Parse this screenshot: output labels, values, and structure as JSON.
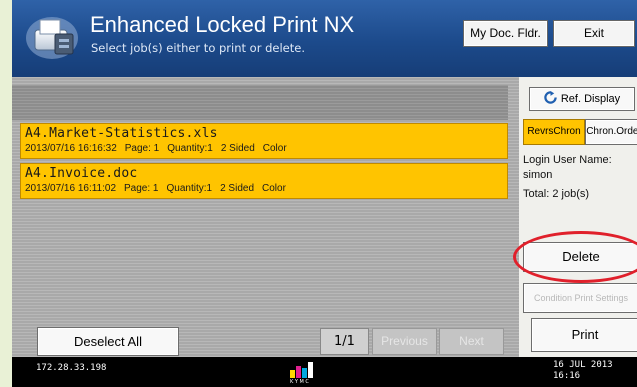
{
  "header": {
    "title": "Enhanced Locked Print NX",
    "subtitle": "Select job(s) either to print or delete.",
    "my_doc_button": "My Doc. Fldr.",
    "exit_button": "Exit"
  },
  "toolbar": {
    "refresh_button": "Ref. Display",
    "sort_reverse": "RevrsChron",
    "sort_chron": "Chron.Order"
  },
  "jobs": [
    {
      "name": "A4.Market-Statistics.xls",
      "datetime": "2013/07/16 16:16:32",
      "pages": "Page: 1",
      "quantity": "Quantity:1",
      "sides": "2 Sided",
      "color": "Color"
    },
    {
      "name": "A4.Invoice.doc",
      "datetime": "2013/07/16 16:11:02",
      "pages": "Page: 1",
      "quantity": "Quantity:1",
      "sides": "2 Sided",
      "color": "Color"
    }
  ],
  "info": {
    "login_label": "Login User Name:",
    "user": "simon",
    "total": "Total: 2 job(s)"
  },
  "actions": {
    "delete": "Delete",
    "condition": "Condition Print Settings",
    "print": "Print",
    "deselect_all": "Deselect All"
  },
  "pagination": {
    "page": "1/1",
    "previous": "Previous",
    "next": "Next"
  },
  "status": {
    "ip": "172.28.33.198",
    "date": "16 JUL  2013",
    "time": "16:16"
  },
  "colors": {
    "header_blue": "#1c4a8b",
    "selected_job": "#ffc400",
    "highlight_circle": "#e0202b"
  },
  "icons": [
    "printer-app-icon",
    "refresh-icon",
    "toner-level-icon"
  ]
}
